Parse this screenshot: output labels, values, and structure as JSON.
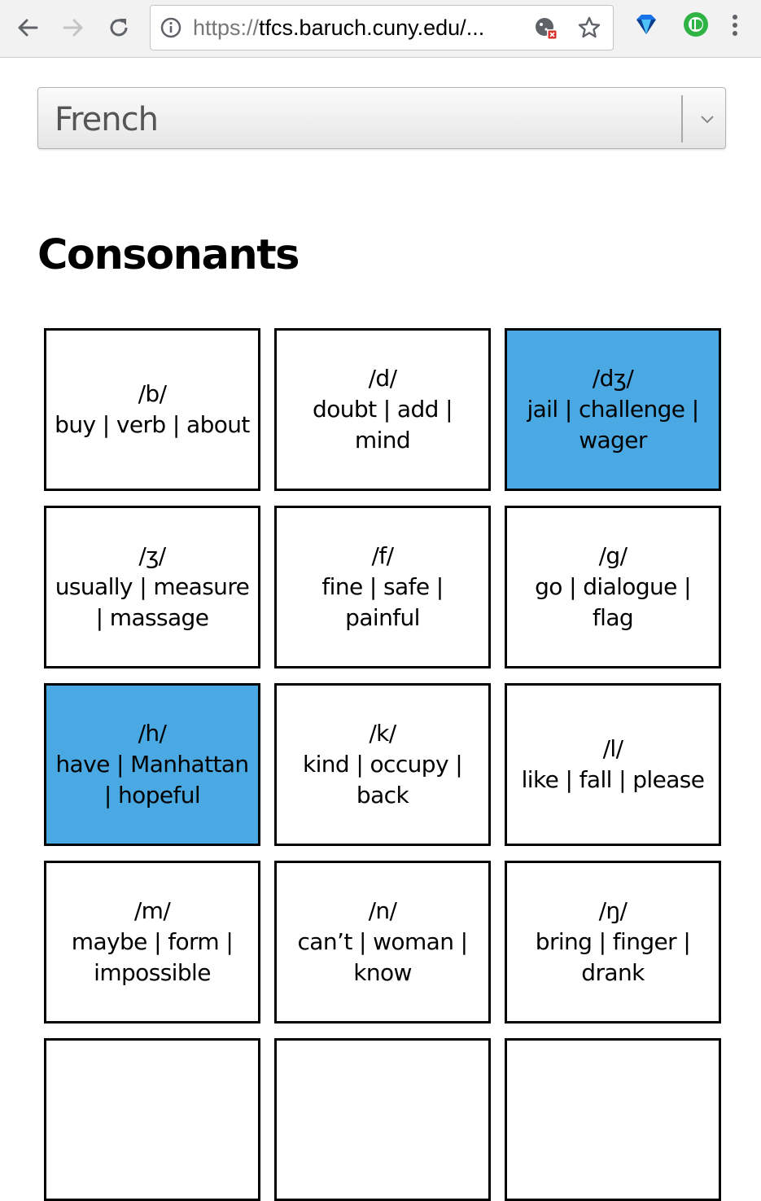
{
  "browser": {
    "url_scheme": "https://",
    "url_host": "tfcs.baruch.cuny.edu/..."
  },
  "language_select": {
    "selected": "French"
  },
  "section": {
    "title": "Consonants"
  },
  "cards": [
    {
      "ipa": "/b/",
      "words": "buy | verb | about",
      "highlighted": false
    },
    {
      "ipa": "/d/",
      "words": "doubt | add | mind",
      "highlighted": false
    },
    {
      "ipa": "/dʒ/",
      "words": "jail | challenge | wager",
      "highlighted": true
    },
    {
      "ipa": "/ʒ/",
      "words": "usually | measure | massage",
      "highlighted": false
    },
    {
      "ipa": "/f/",
      "words": "fine | safe | painful",
      "highlighted": false
    },
    {
      "ipa": "/g/",
      "words": "go | dialogue | flag",
      "highlighted": false
    },
    {
      "ipa": "/h/",
      "words": "have | Manhattan | hopeful",
      "highlighted": true
    },
    {
      "ipa": "/k/",
      "words": "kind | occupy | back",
      "highlighted": false
    },
    {
      "ipa": "/l/",
      "words": "like | fall | please",
      "highlighted": false
    },
    {
      "ipa": "/m/",
      "words": "maybe | form | impossible",
      "highlighted": false
    },
    {
      "ipa": "/n/",
      "words": "can’t | woman | know",
      "highlighted": false
    },
    {
      "ipa": "/ŋ/",
      "words": "bring | finger | drank",
      "highlighted": false
    }
  ],
  "colors": {
    "highlight": "#4aa9e3",
    "card_border": "#000000"
  },
  "icons": [
    "back-arrow-icon",
    "forward-arrow-icon",
    "reload-icon",
    "info-icon",
    "cookie-blocked-icon",
    "star-icon",
    "diamond-extension-icon",
    "green-extension-icon",
    "menu-dots-icon",
    "chevron-down-icon"
  ]
}
